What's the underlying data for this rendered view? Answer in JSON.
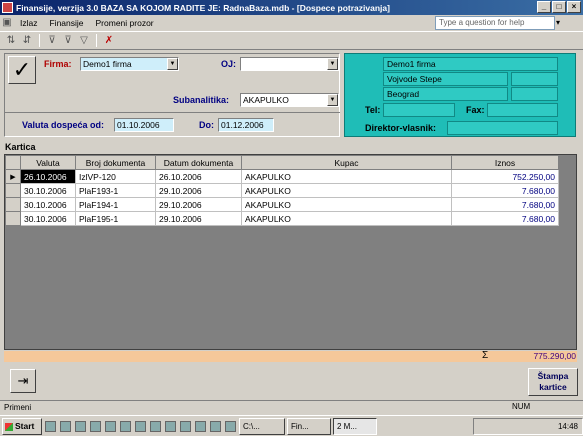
{
  "window": {
    "title": "Finansije, verzija 3.0     BAZA SA KOJOM RADITE JE: RadnaBaza.mdb - [Dospece potrazivanja]"
  },
  "menu": {
    "items": [
      "Izlaz",
      "Finansije",
      "Promeni prozor"
    ],
    "help_placeholder": "Type a question for help"
  },
  "form": {
    "firma_label": "Firma:",
    "firma_value": "Demo1 firma",
    "oj_label": "OJ:",
    "oj_value": "",
    "subanalitika_label": "Subanalitika:",
    "subanalitika_value": "AKAPULKO",
    "valuta_label": "Valuta dospeća od:",
    "valuta_od": "01.10.2006",
    "do_label": "Do:",
    "valuta_do": "01.12.2006"
  },
  "company": {
    "name": "Demo1 firma",
    "address": "Vojvode Stepe",
    "city": "Beograd",
    "tel_label": "Tel:",
    "fax_label": "Fax:",
    "director_label": "Direktor-vlasnik:"
  },
  "kartica": {
    "label": "Kartica",
    "columns": [
      "Valuta",
      "Broj dokumenta",
      "Datum dokumenta",
      "Kupac",
      "Iznos"
    ],
    "rows": [
      {
        "valuta": "26.10.2006",
        "broj": "IzlVP-120",
        "datum": "26.10.2006",
        "kupac": "AKAPULKO",
        "iznos": "752.250,00"
      },
      {
        "valuta": "30.10.2006",
        "broj": "PlaF193-1",
        "datum": "29.10.2006",
        "kupac": "AKAPULKO",
        "iznos": "7.680,00"
      },
      {
        "valuta": "30.10.2006",
        "broj": "PlaF194-1",
        "datum": "29.10.2006",
        "kupac": "AKAPULKO",
        "iznos": "7.680,00"
      },
      {
        "valuta": "30.10.2006",
        "broj": "PlaF195-1",
        "datum": "29.10.2006",
        "kupac": "AKAPULKO",
        "iznos": "7.680,00"
      }
    ],
    "sigma": "Σ",
    "total": "775.290,00"
  },
  "buttons": {
    "print_line1": "Štampa",
    "print_line2": "kartice"
  },
  "status": {
    "left": "Primeni",
    "num": "NUM"
  },
  "taskbar": {
    "start": "Start",
    "tasks": [
      "C:\\...",
      "Fin...",
      "2 M..."
    ],
    "clock": "14:48"
  }
}
